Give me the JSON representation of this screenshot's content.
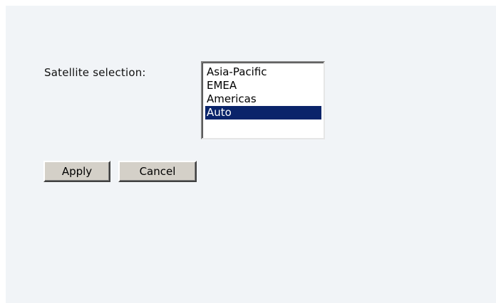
{
  "form": {
    "satellite_label": "Satellite selection:",
    "satellite_options": [
      "Asia-Pacific",
      "EMEA",
      "Americas",
      "Auto"
    ],
    "selected_option": "Auto"
  },
  "buttons": {
    "apply_label": "Apply",
    "cancel_label": "Cancel"
  },
  "colors": {
    "panel_background": "#f1f4f7",
    "selection_highlight": "#0a246a",
    "button_face": "#d4d0c8"
  }
}
